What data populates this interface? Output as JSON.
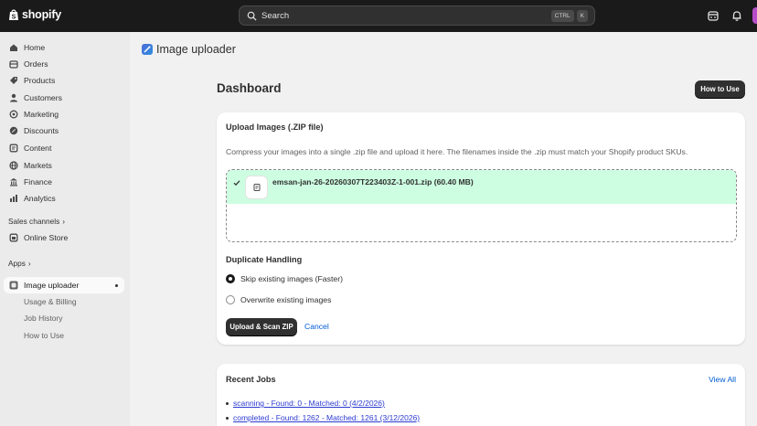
{
  "topbar": {
    "brand": "shopify",
    "search_placeholder": "Search",
    "shortcut_key1": "CTRL",
    "shortcut_key2": "K"
  },
  "sidebar": {
    "items": [
      {
        "label": "Home",
        "icon": "home-icon"
      },
      {
        "label": "Orders",
        "icon": "orders-icon"
      },
      {
        "label": "Products",
        "icon": "tag-icon"
      },
      {
        "label": "Customers",
        "icon": "person-icon"
      },
      {
        "label": "Marketing",
        "icon": "target-icon"
      },
      {
        "label": "Discounts",
        "icon": "discount-icon"
      },
      {
        "label": "Content",
        "icon": "content-icon"
      },
      {
        "label": "Markets",
        "icon": "globe-icon"
      },
      {
        "label": "Finance",
        "icon": "bank-icon"
      },
      {
        "label": "Analytics",
        "icon": "chart-icon"
      }
    ],
    "sales_channels_label": "Sales channels",
    "online_store_label": "Online Store",
    "apps_label": "Apps",
    "app_name": "Image uploader",
    "app_subitems": [
      "Usage & Billing",
      "Job History",
      "How to Use"
    ]
  },
  "page": {
    "app_header_title": "Image uploader",
    "title": "Dashboard",
    "how_to_use_button": "How to Use"
  },
  "upload_card": {
    "title": "Upload Images (.ZIP file)",
    "help_text": "Compress your images into a single .zip file and upload it here. The filenames inside the .zip must match your Shopify product SKUs.",
    "file_name": "emsan-jan-26-20260307T223403Z-1-001.zip (60.40 MB)",
    "duplicate_heading": "Duplicate Handling",
    "options": [
      {
        "label": "Skip existing images (Faster)",
        "selected": true
      },
      {
        "label": "Overwrite existing images",
        "selected": false
      }
    ],
    "upload_button": "Upload & Scan ZIP",
    "cancel_link": "Cancel"
  },
  "jobs_card": {
    "title": "Recent Jobs",
    "view_all": "View All",
    "jobs": [
      "scanning - Found: 0 - Matched: 0 (4/2/2026)",
      "completed - Found: 1262 - Matched: 1261 (3/12/2026)"
    ]
  },
  "colors": {
    "topbar": "#1a1a1a",
    "success_fill": "#cdfee1",
    "link": "#005bd3",
    "primary_button": "#303030"
  }
}
